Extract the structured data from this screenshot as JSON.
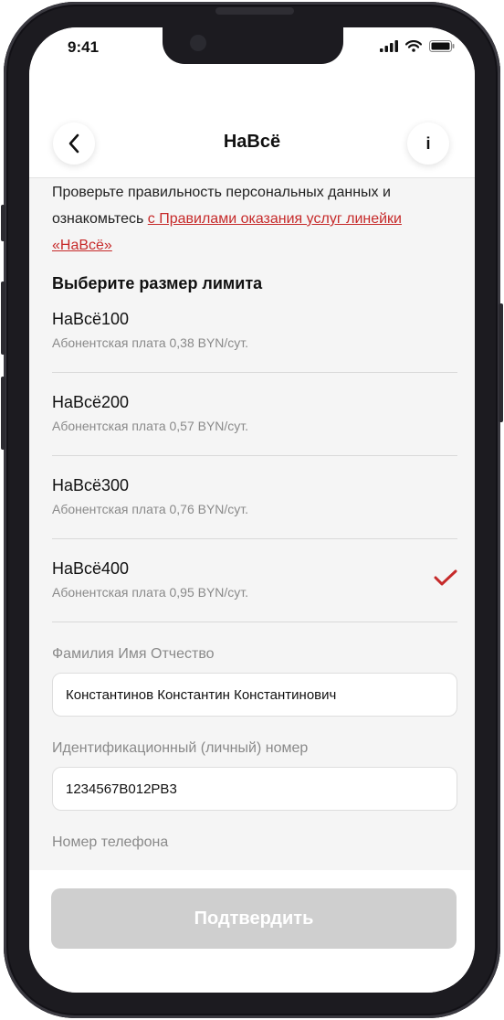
{
  "status": {
    "time": "9:41"
  },
  "header": {
    "title": "НаВсё",
    "info_icon": "i"
  },
  "intro": {
    "text": "Проверьте правильность персональных данных и ознакомьтесь ",
    "link": "с Правилами оказания услуг линейки «НаВсё»"
  },
  "limit": {
    "title": "Выберите размер лимита",
    "options": [
      {
        "name": "НаВсё100",
        "fee": "Абонентская плата 0,38 BYN/сут.",
        "selected": false
      },
      {
        "name": "НаВсё200",
        "fee": "Абонентская плата 0,57 BYN/сут.",
        "selected": false
      },
      {
        "name": "НаВсё300",
        "fee": "Абонентская плата 0,76 BYN/сут.",
        "selected": false
      },
      {
        "name": "НаВсё400",
        "fee": "Абонентская плата 0,95 BYN/сут.",
        "selected": true
      }
    ]
  },
  "form": {
    "name_label": "Фамилия Имя Отчество",
    "name_value": "Константинов Константин Константинович",
    "id_label": "Идентификационный (личный) номер",
    "id_value": "1234567B012PB3",
    "phone_label": "Номер телефона"
  },
  "confirm_label": "Подтвердить",
  "colors": {
    "accent": "#c62a2a",
    "disabled_button": "#cfcfcf"
  }
}
